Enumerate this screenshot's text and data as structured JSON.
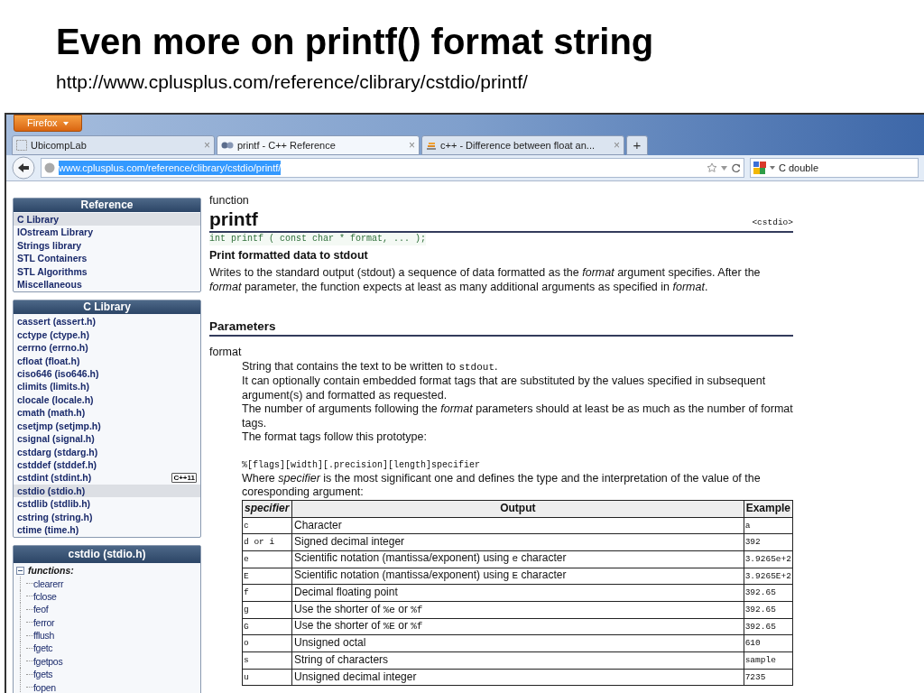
{
  "slide": {
    "title": "Even more on printf() format string",
    "url": "http://www.cplusplus.com/reference/clibrary/cstdio/printf/"
  },
  "browser": {
    "menu_button": "Firefox",
    "tabs": [
      {
        "label": "UbicompLab",
        "selected": false,
        "close": "×"
      },
      {
        "label": "printf - C++ Reference",
        "selected": true,
        "close": "×"
      },
      {
        "label": "c++ - Difference between float an...",
        "selected": false,
        "close": "×"
      }
    ],
    "new_tab": "+",
    "address": {
      "value": "www.cplusplus.com/reference/clibrary/cstdio/printf/",
      "selected": true
    },
    "search": {
      "value": "C double"
    }
  },
  "sidebar": {
    "panels": [
      {
        "title": "Reference",
        "items": [
          {
            "label": "C Library",
            "selected": true
          },
          {
            "label": "IOstream Library",
            "selected": false
          },
          {
            "label": "Strings library",
            "selected": false
          },
          {
            "label": "STL Containers",
            "selected": false
          },
          {
            "label": "STL Algorithms",
            "selected": false
          },
          {
            "label": "Miscellaneous",
            "selected": false
          }
        ]
      },
      {
        "title": "C Library",
        "items": [
          {
            "label": "cassert (assert.h)",
            "selected": false
          },
          {
            "label": "cctype (ctype.h)",
            "selected": false
          },
          {
            "label": "cerrno (errno.h)",
            "selected": false
          },
          {
            "label": "cfloat (float.h)",
            "selected": false
          },
          {
            "label": "ciso646 (iso646.h)",
            "selected": false
          },
          {
            "label": "climits (limits.h)",
            "selected": false
          },
          {
            "label": "clocale (locale.h)",
            "selected": false
          },
          {
            "label": "cmath (math.h)",
            "selected": false
          },
          {
            "label": "csetjmp (setjmp.h)",
            "selected": false
          },
          {
            "label": "csignal (signal.h)",
            "selected": false
          },
          {
            "label": "cstdarg (stdarg.h)",
            "selected": false
          },
          {
            "label": "cstddef (stddef.h)",
            "selected": false
          },
          {
            "label": "cstdint (stdint.h)",
            "selected": false,
            "badge": "C++11"
          },
          {
            "label": "cstdio (stdio.h)",
            "selected": true
          },
          {
            "label": "cstdlib (stdlib.h)",
            "selected": false
          },
          {
            "label": "cstring (string.h)",
            "selected": false
          },
          {
            "label": "ctime (time.h)",
            "selected": false
          }
        ]
      }
    ],
    "tree_panel": {
      "title": "cstdio (stdio.h)",
      "group": {
        "label": "functions:",
        "expanded": true,
        "children": [
          {
            "label": "clearerr"
          },
          {
            "label": "fclose"
          },
          {
            "label": "feof"
          },
          {
            "label": "ferror"
          },
          {
            "label": "fflush"
          },
          {
            "label": "fgetc"
          },
          {
            "label": "fgetpos"
          },
          {
            "label": "fgets"
          },
          {
            "label": "fopen"
          }
        ]
      }
    }
  },
  "content": {
    "kind_label": "function",
    "name": "printf",
    "header": "<cstdio>",
    "prototype": "int printf ( const char * format, ... );",
    "summary": "Print formatted data to stdout",
    "description": "Writes to the standard output (stdout) a sequence of data formatted as the *format* argument specifies. After the *format* parameter, the function expects at least as many additional arguments as specified in *format*.",
    "section_title": "Parameters",
    "param_name": "format",
    "param_lines": [
      [
        {
          "kind": "text",
          "text": "String that contains the text to be written to "
        },
        {
          "kind": "code",
          "text": "stdout"
        },
        {
          "kind": "text",
          "text": "."
        }
      ],
      [
        {
          "kind": "text",
          "text": "It can optionally contain embedded format tags that are substituted by the values specified in subsequent argument(s) and formatted as requested."
        }
      ],
      [
        {
          "kind": "text",
          "text": "The number of arguments following the *format* parameters should at least be as much as the number of format tags."
        }
      ],
      [
        {
          "kind": "text",
          "text": "The format tags follow this prototype:"
        }
      ]
    ],
    "format_spec": "%[flags][width][.precision][length]specifier",
    "where_text": "Where *specifier* is the most significant one and defines the type and the interpretation of the value of the coresponding argument:",
    "table": {
      "columns": [
        "specifier",
        "Output",
        "Example"
      ],
      "rows": [
        {
          "specifier": "c",
          "output": [
            {
              "kind": "text",
              "text": "Character"
            }
          ],
          "example": "a"
        },
        {
          "specifier": "d or i",
          "output": [
            {
              "kind": "text",
              "text": "Signed decimal integer"
            }
          ],
          "example": "392"
        },
        {
          "specifier": "e",
          "output": [
            {
              "kind": "text",
              "text": "Scientific notation (mantissa/exponent) using "
            },
            {
              "kind": "code",
              "text": "e"
            },
            {
              "kind": "text",
              "text": " character"
            }
          ],
          "example": "3.9265e+2"
        },
        {
          "specifier": "E",
          "output": [
            {
              "kind": "text",
              "text": "Scientific notation (mantissa/exponent) using "
            },
            {
              "kind": "code",
              "text": "E"
            },
            {
              "kind": "text",
              "text": " character"
            }
          ],
          "example": "3.9265E+2"
        },
        {
          "specifier": "f",
          "output": [
            {
              "kind": "text",
              "text": "Decimal floating point"
            }
          ],
          "example": "392.65"
        },
        {
          "specifier": "g",
          "output": [
            {
              "kind": "text",
              "text": "Use the shorter of "
            },
            {
              "kind": "code",
              "text": "%e"
            },
            {
              "kind": "text",
              "text": " or "
            },
            {
              "kind": "code",
              "text": "%f"
            }
          ],
          "example": "392.65"
        },
        {
          "specifier": "G",
          "output": [
            {
              "kind": "text",
              "text": "Use the shorter of "
            },
            {
              "kind": "code",
              "text": "%E"
            },
            {
              "kind": "text",
              "text": " or "
            },
            {
              "kind": "code",
              "text": "%f"
            }
          ],
          "example": "392.65"
        },
        {
          "specifier": "o",
          "output": [
            {
              "kind": "text",
              "text": "Unsigned octal"
            }
          ],
          "example": "610"
        },
        {
          "specifier": "s",
          "output": [
            {
              "kind": "text",
              "text": "String of characters"
            }
          ],
          "example": "sample"
        },
        {
          "specifier": "u",
          "output": [
            {
              "kind": "text",
              "text": "Unsigned decimal integer"
            }
          ],
          "example": "7235"
        }
      ]
    }
  }
}
